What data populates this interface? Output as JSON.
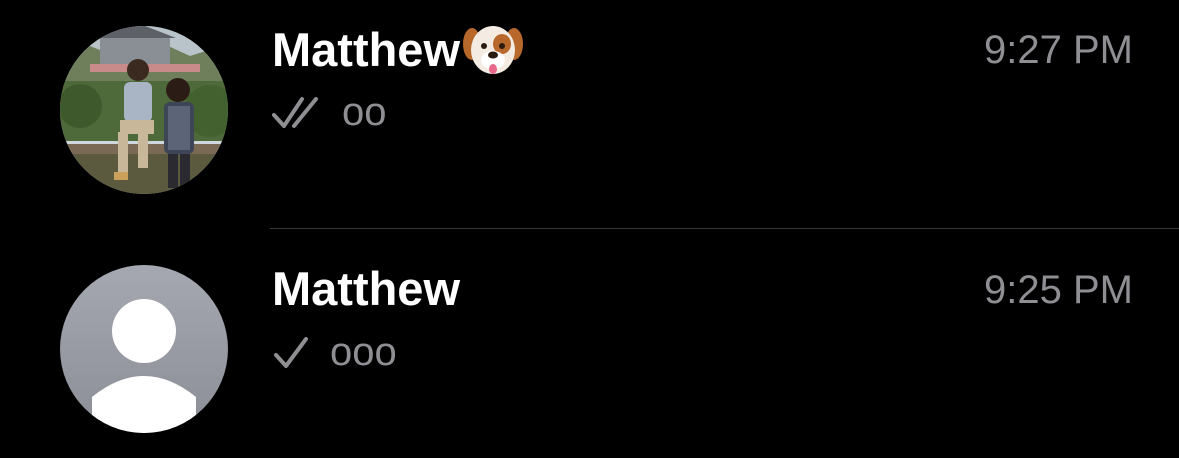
{
  "chats": [
    {
      "name": "Matthew",
      "name_emoji": "dog-face-emoji",
      "time": "9:27 PM",
      "preview": "oo",
      "status_icon": "double-check-icon",
      "avatar": "photo-avatar"
    },
    {
      "name": "Matthew",
      "time": "9:25 PM",
      "preview": "ooo",
      "status_icon": "single-check-icon",
      "avatar": "default-person-avatar"
    }
  ],
  "colors": {
    "background": "#000000",
    "name_text": "#ffffff",
    "secondary_text": "#8e8e93",
    "separator": "#38383a",
    "default_avatar_bg": "#9a9da5"
  }
}
